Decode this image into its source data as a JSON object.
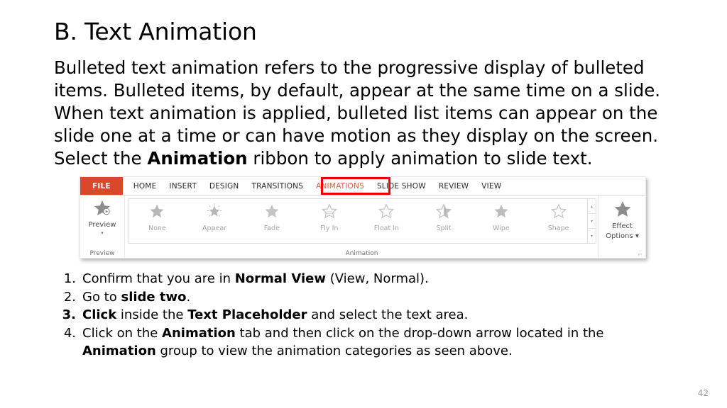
{
  "slide": {
    "title": "B. Text Animation",
    "page_number": "42"
  },
  "body": {
    "part1": "Bulleted text animation refers to the progressive display of bulleted items. Bulleted items, by default, appear at the same time on a slide. When text animation is applied, bulleted list items can appear on the slide one at a time or can have motion as they display on the screen. Select the ",
    "emphasis": "Animation",
    "part2": " ribbon to apply animation to slide text."
  },
  "ribbon": {
    "tabs": [
      {
        "label": "FILE",
        "kind": "file"
      },
      {
        "label": "HOME",
        "kind": "normal"
      },
      {
        "label": "INSERT",
        "kind": "normal"
      },
      {
        "label": "DESIGN",
        "kind": "normal"
      },
      {
        "label": "TRANSITIONS",
        "kind": "normal"
      },
      {
        "label": "ANIMATIONS",
        "kind": "active"
      },
      {
        "label": "SLIDE SHOW",
        "kind": "normal"
      },
      {
        "label": "REVIEW",
        "kind": "normal"
      },
      {
        "label": "VIEW",
        "kind": "normal"
      }
    ],
    "highlight_color": "#f20000",
    "file_tab_color": "#d9482b",
    "active_tab_color": "#e8573d",
    "preview": {
      "label": "Preview",
      "caret": "▾",
      "group_label": "Preview",
      "icon": "star-play-icon"
    },
    "animation_group": {
      "group_label": "Animation",
      "items": [
        {
          "label": "None",
          "icon": "star-solid-icon"
        },
        {
          "label": "Appear",
          "icon": "star-burst-icon"
        },
        {
          "label": "Fade",
          "icon": "star-solid-icon"
        },
        {
          "label": "Fly In",
          "icon": "star-fly-in-icon"
        },
        {
          "label": "Float In",
          "icon": "star-outline-icon"
        },
        {
          "label": "Split",
          "icon": "star-split-icon"
        },
        {
          "label": "Wipe",
          "icon": "star-solid-icon"
        },
        {
          "label": "Shape",
          "icon": "star-outline-icon"
        }
      ],
      "scroll_up": "▴",
      "scroll_down": "▾",
      "scroll_more": "▾"
    },
    "effect_options": {
      "line1": "Effect",
      "line2": "Options ▾",
      "icon": "star-solid-icon",
      "dialog_launcher": "⌐"
    }
  },
  "steps": [
    {
      "number": "1.",
      "number_bold": false,
      "segments": [
        {
          "text": "Confirm that you are in ",
          "bold": false
        },
        {
          "text": "Normal View",
          "bold": true
        },
        {
          "text": " (View, Normal).",
          "bold": false
        }
      ]
    },
    {
      "number": "2.",
      "number_bold": false,
      "segments": [
        {
          "text": "Go to ",
          "bold": false
        },
        {
          "text": "slide two",
          "bold": true
        },
        {
          "text": ".",
          "bold": false
        }
      ]
    },
    {
      "number": "3.",
      "number_bold": true,
      "segments": [
        {
          "text": "Click",
          "bold": true
        },
        {
          "text": " inside the ",
          "bold": false
        },
        {
          "text": "Text Placeholder",
          "bold": true
        },
        {
          "text": " and select the text area.",
          "bold": false
        }
      ]
    },
    {
      "number": "4.",
      "number_bold": false,
      "segments": [
        {
          "text": "Click on the ",
          "bold": false
        },
        {
          "text": "Animation",
          "bold": true
        },
        {
          "text": " tab and then click on the drop-down arrow located in the ",
          "bold": false
        },
        {
          "text": "Animation",
          "bold": true
        },
        {
          "text": " group to view the animation categories as seen above.",
          "bold": false
        }
      ]
    }
  ]
}
